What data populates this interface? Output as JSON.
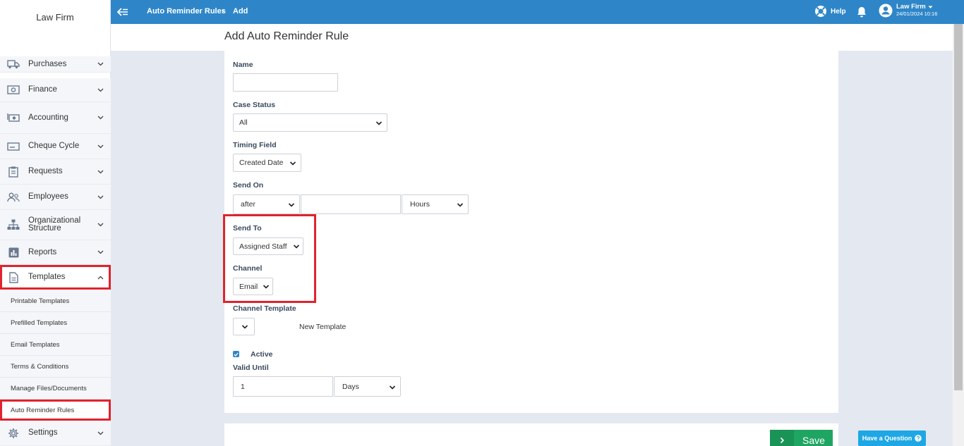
{
  "sidebar": {
    "brand": "Law Firm",
    "items": [
      {
        "label": "Purchases",
        "icon": "truck-icon"
      },
      {
        "label": "Finance",
        "icon": "cash-icon"
      },
      {
        "label": "Accounting",
        "icon": "money-icon"
      },
      {
        "label": "Cheque Cycle",
        "icon": "cheque-icon"
      },
      {
        "label": "Requests",
        "icon": "clipboard-icon"
      },
      {
        "label": "Employees",
        "icon": "people-icon"
      },
      {
        "label": "Organizational Structure",
        "icon": "hierarchy-icon"
      },
      {
        "label": "Reports",
        "icon": "bar-chart-icon"
      },
      {
        "label": "Templates",
        "icon": "document-icon"
      }
    ],
    "sub_items": [
      "Printable Templates",
      "Prefilled Templates",
      "Email Templates",
      "Terms & Conditions",
      "Manage Files/Documents",
      "Auto Reminder Rules"
    ],
    "settings_label": "Settings"
  },
  "topbar": {
    "crumb_parent": "Auto Reminder Rules",
    "crumb_sep": "›",
    "crumb_current": "Add",
    "help_label": "Help",
    "user_name": "Law Firm",
    "user_date": "24/01/2024 10:16"
  },
  "page": {
    "title": "Add Auto Reminder Rule"
  },
  "form": {
    "name_label": "Name",
    "name_value": "",
    "case_status_label": "Case Status",
    "case_status_value": "All",
    "timing_field_label": "Timing Field",
    "timing_field_value": "Created Date",
    "send_on_label": "Send On",
    "send_on_direction": "after",
    "send_on_amount": "",
    "send_on_unit": "Hours",
    "send_to_label": "Send To",
    "send_to_value": "Assigned Staff",
    "channel_label": "Channel",
    "channel_value": "Email",
    "channel_template_label": "Channel Template",
    "channel_template_value": "",
    "new_template_link": "New Template",
    "active_label": "Active",
    "active_checked": true,
    "valid_until_label": "Valid Until",
    "valid_until_value": "1",
    "valid_until_unit": "Days"
  },
  "footer": {
    "save_label": "Save",
    "question_label": "Have a Question"
  },
  "colors": {
    "topbar": "#2e86c8",
    "highlight": "#e0232d",
    "save": "#1fa562",
    "question": "#1ea7e4"
  }
}
